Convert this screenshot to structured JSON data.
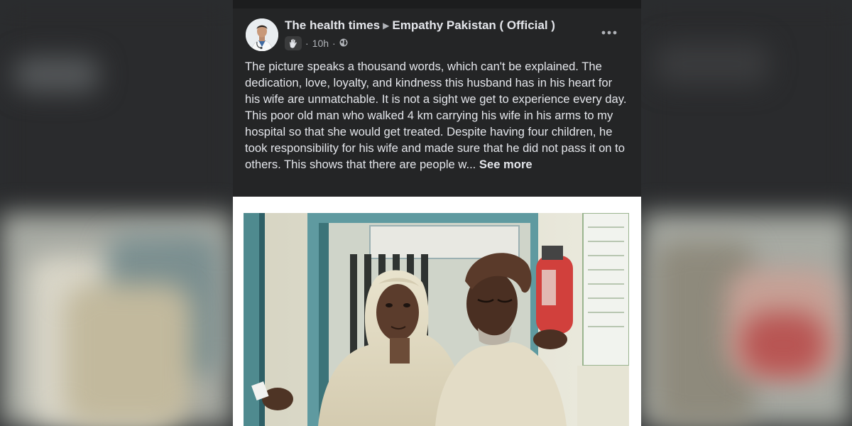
{
  "post": {
    "author": "The health times",
    "group": "Empathy Pakistan ( Official )",
    "time": "10h",
    "separator": "·",
    "badge_icon": "waving-hand-icon",
    "audience_icon": "globe-icon",
    "menu_icon": "more-options-icon",
    "text": "The picture speaks a thousand words, which can't be explained. The dedication, love, loyalty, and kindness this husband has in his heart for his wife are unmatchable. It is not a sight we get to experience every day. This poor old man who walked 4 km carrying his wife in his arms to my hospital  so that she would get treated. Despite having four children, he took responsibility for his wife and made sure that he did not pass it on to others. This shows that there are people w...",
    "see_more": "See more"
  },
  "colors": {
    "card_bg": "#242526",
    "text": "#e4e6eb",
    "secondary_text": "#b0b3b8",
    "page_bg": "#2b2d2f"
  }
}
